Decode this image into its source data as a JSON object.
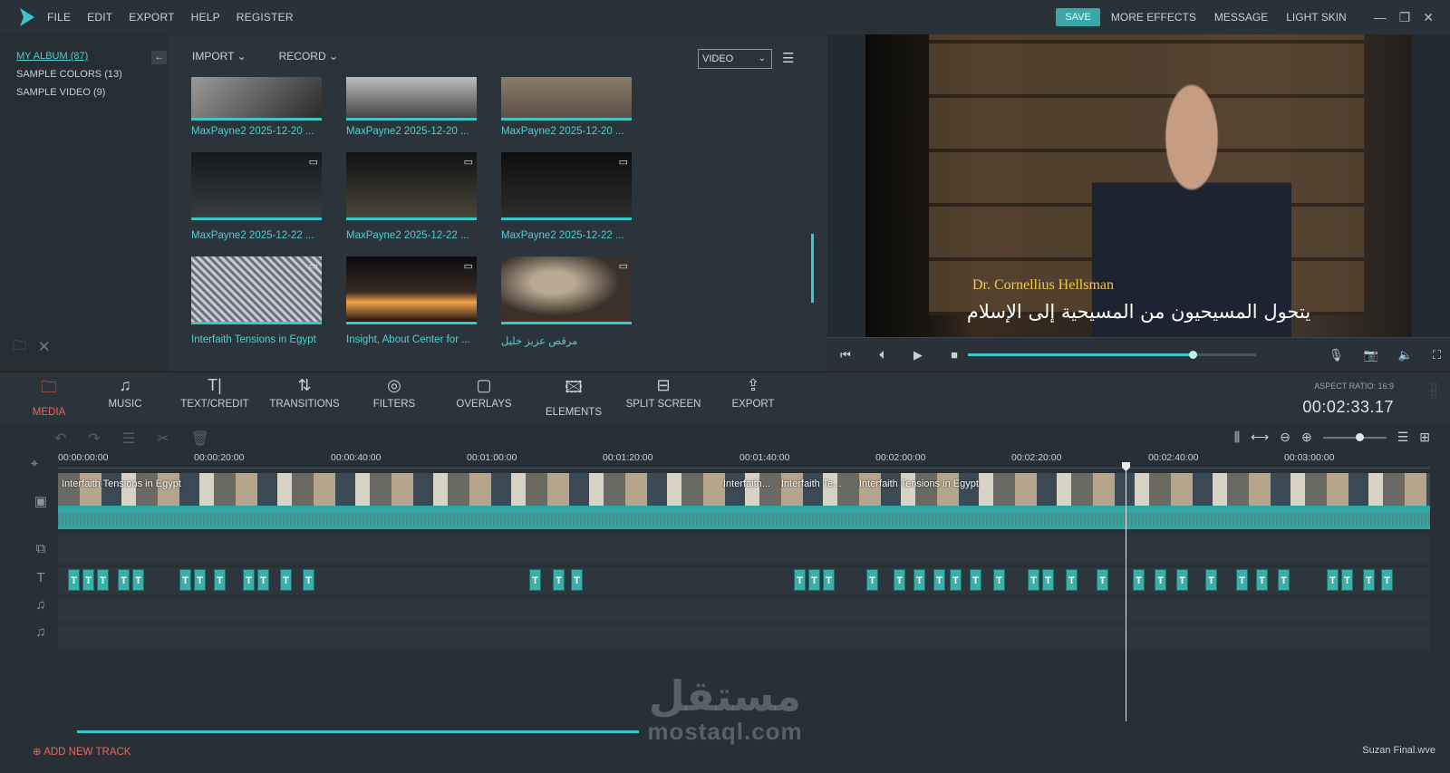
{
  "menu": [
    "FILE",
    "EDIT",
    "EXPORT",
    "HELP",
    "REGISTER"
  ],
  "top_right": {
    "save": "SAVE",
    "more_effects": "MORE EFFECTS",
    "message": "MESSAGE",
    "light_skin": "LIGHT SKIN"
  },
  "album": {
    "items": [
      "MY ALBUM (87)",
      "SAMPLE COLORS (13)",
      "SAMPLE VIDEO (9)"
    ]
  },
  "media": {
    "import": "IMPORT",
    "record": "RECORD",
    "filter_value": "VIDEO",
    "thumbnails": [
      {
        "caption": "MaxPayne2 2025-12-20 ..."
      },
      {
        "caption": "MaxPayne2 2025-12-20 ..."
      },
      {
        "caption": "MaxPayne2 2025-12-20 ..."
      },
      {
        "caption": "MaxPayne2 2025-12-22 ..."
      },
      {
        "caption": "MaxPayne2 2025-12-22 ..."
      },
      {
        "caption": "MaxPayne2 2025-12-22 ..."
      },
      {
        "caption": "Interfaith Tensions in Egypt"
      },
      {
        "caption": "Insight, About Center for ..."
      },
      {
        "caption": "مرقص عزيز خليل"
      }
    ]
  },
  "preview": {
    "nameplate": "Dr. Cornellius Hellsman",
    "subtitle": "يتحول المسيحيون من المسيحية إلى الإسلام",
    "progress": 0.78
  },
  "tools": [
    {
      "label": "MEDIA",
      "icon": "folder-icon",
      "active": true
    },
    {
      "label": "MUSIC",
      "icon": "music-note-icon",
      "active": false
    },
    {
      "label": "TEXT/CREDIT",
      "icon": "text-icon",
      "active": false
    },
    {
      "label": "TRANSITIONS",
      "icon": "transitions-icon",
      "active": false
    },
    {
      "label": "FILTERS",
      "icon": "filters-icon",
      "active": false
    },
    {
      "label": "OVERLAYS",
      "icon": "overlays-icon",
      "active": false
    },
    {
      "label": "ELEMENTS",
      "icon": "image-icon",
      "active": false
    },
    {
      "label": "SPLIT SCREEN",
      "icon": "split-screen-icon",
      "active": false
    },
    {
      "label": "EXPORT",
      "icon": "share-icon",
      "active": false
    }
  ],
  "aspect_ratio": "ASPECT RATIO: 16:9",
  "timecode": "00:02:33.17",
  "timeline": {
    "ticks": [
      "00:00:00:00",
      "00:00:20:00",
      "00:00:40:00",
      "00:01:00:00",
      "00:01:20:00",
      "00:01:40:00",
      "00:02:00:00",
      "00:02:20:00",
      "00:02:40:00",
      "00:03:00:00"
    ],
    "clip_labels": [
      "Interfaith Tensions in Egypt",
      "Interfaith...",
      "Interfaith Te...",
      "Interfaith Tensions in Egypt"
    ],
    "add_track": "ADD NEW TRACK",
    "filename": "Suzan Final.wve"
  },
  "watermark": {
    "arabic": "مستقل",
    "latin": "mostaql.com"
  },
  "colors": {
    "accent": "#3ec7c7",
    "active_tab": "#f0645a",
    "background": "#2b333b"
  }
}
